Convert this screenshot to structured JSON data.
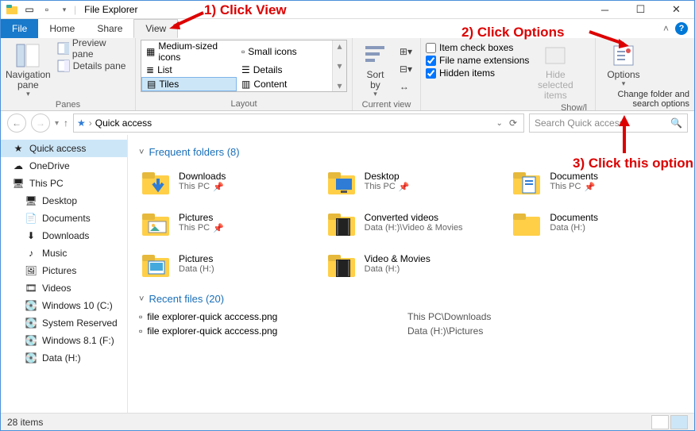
{
  "window": {
    "title": "File Explorer"
  },
  "menubar": {
    "file": "File",
    "tabs": [
      "Home",
      "Share",
      "View"
    ],
    "active": "View"
  },
  "ribbon": {
    "panes": {
      "nav": "Navigation\npane",
      "preview": "Preview pane",
      "details": "Details pane",
      "group_label": "Panes"
    },
    "layout": {
      "items": [
        "Medium-sized icons",
        "Small icons",
        "List",
        "Details",
        "Tiles",
        "Content"
      ],
      "selected": "Tiles",
      "group_label": "Layout"
    },
    "current_view": {
      "sort": "Sort\nby",
      "group_label": "Current view"
    },
    "show_hide": {
      "check1": "Item check boxes",
      "check2": "File name extensions",
      "check3": "Hidden items",
      "check2_on": true,
      "check3_on": true,
      "hide_selected": "Hide selected\nitems",
      "group_label": "Show/l"
    },
    "options": {
      "label": "Options",
      "sub": "Change folder and search options"
    }
  },
  "address": {
    "path": "Quick access",
    "search_placeholder": "Search Quick access"
  },
  "sidebar": {
    "items": [
      {
        "label": "Quick access",
        "icon": "star",
        "sel": true
      },
      {
        "label": "OneDrive",
        "icon": "cloud"
      },
      {
        "label": "This PC",
        "icon": "pc"
      },
      {
        "label": "Desktop",
        "icon": "desktop",
        "sub": true
      },
      {
        "label": "Documents",
        "icon": "doc",
        "sub": true
      },
      {
        "label": "Downloads",
        "icon": "down",
        "sub": true
      },
      {
        "label": "Music",
        "icon": "music",
        "sub": true
      },
      {
        "label": "Pictures",
        "icon": "pic",
        "sub": true
      },
      {
        "label": "Videos",
        "icon": "vid",
        "sub": true
      },
      {
        "label": "Windows 10 (C:)",
        "icon": "drive",
        "sub": true
      },
      {
        "label": "System Reserved",
        "icon": "drive",
        "sub": true
      },
      {
        "label": "Windows 8.1 (F:)",
        "icon": "drive",
        "sub": true
      },
      {
        "label": "Data (H:)",
        "icon": "drive",
        "sub": true
      }
    ]
  },
  "content": {
    "frequent": {
      "header": "Frequent folders (8)",
      "items": [
        {
          "name": "Downloads",
          "loc": "This PC",
          "pinned": true,
          "icon": "down"
        },
        {
          "name": "Desktop",
          "loc": "This PC",
          "pinned": true,
          "icon": "desktop"
        },
        {
          "name": "Documents",
          "loc": "This PC",
          "pinned": true,
          "icon": "doc"
        },
        {
          "name": "Pictures",
          "loc": "This PC",
          "pinned": true,
          "icon": "pic"
        },
        {
          "name": "Converted videos",
          "loc": "Data (H:)\\Video & Movies",
          "icon": "vid"
        },
        {
          "name": "Documents",
          "loc": "Data (H:)",
          "icon": "folder"
        },
        {
          "name": "Pictures",
          "loc": "Data (H:)",
          "icon": "picfolder"
        },
        {
          "name": "Video & Movies",
          "loc": "Data (H:)",
          "icon": "vidfolder"
        }
      ]
    },
    "recent": {
      "header": "Recent files (20)",
      "items": [
        {
          "name": "file explorer-quick acccess.png",
          "loc": "This PC\\Downloads"
        },
        {
          "name": "file explorer-quick acccess.png",
          "loc": "Data (H:)\\Pictures"
        }
      ]
    }
  },
  "statusbar": {
    "text": "28 items"
  },
  "annotations": {
    "a1": "1) Click View",
    "a2": "2) Click Options",
    "a3": "3) Click this option"
  }
}
